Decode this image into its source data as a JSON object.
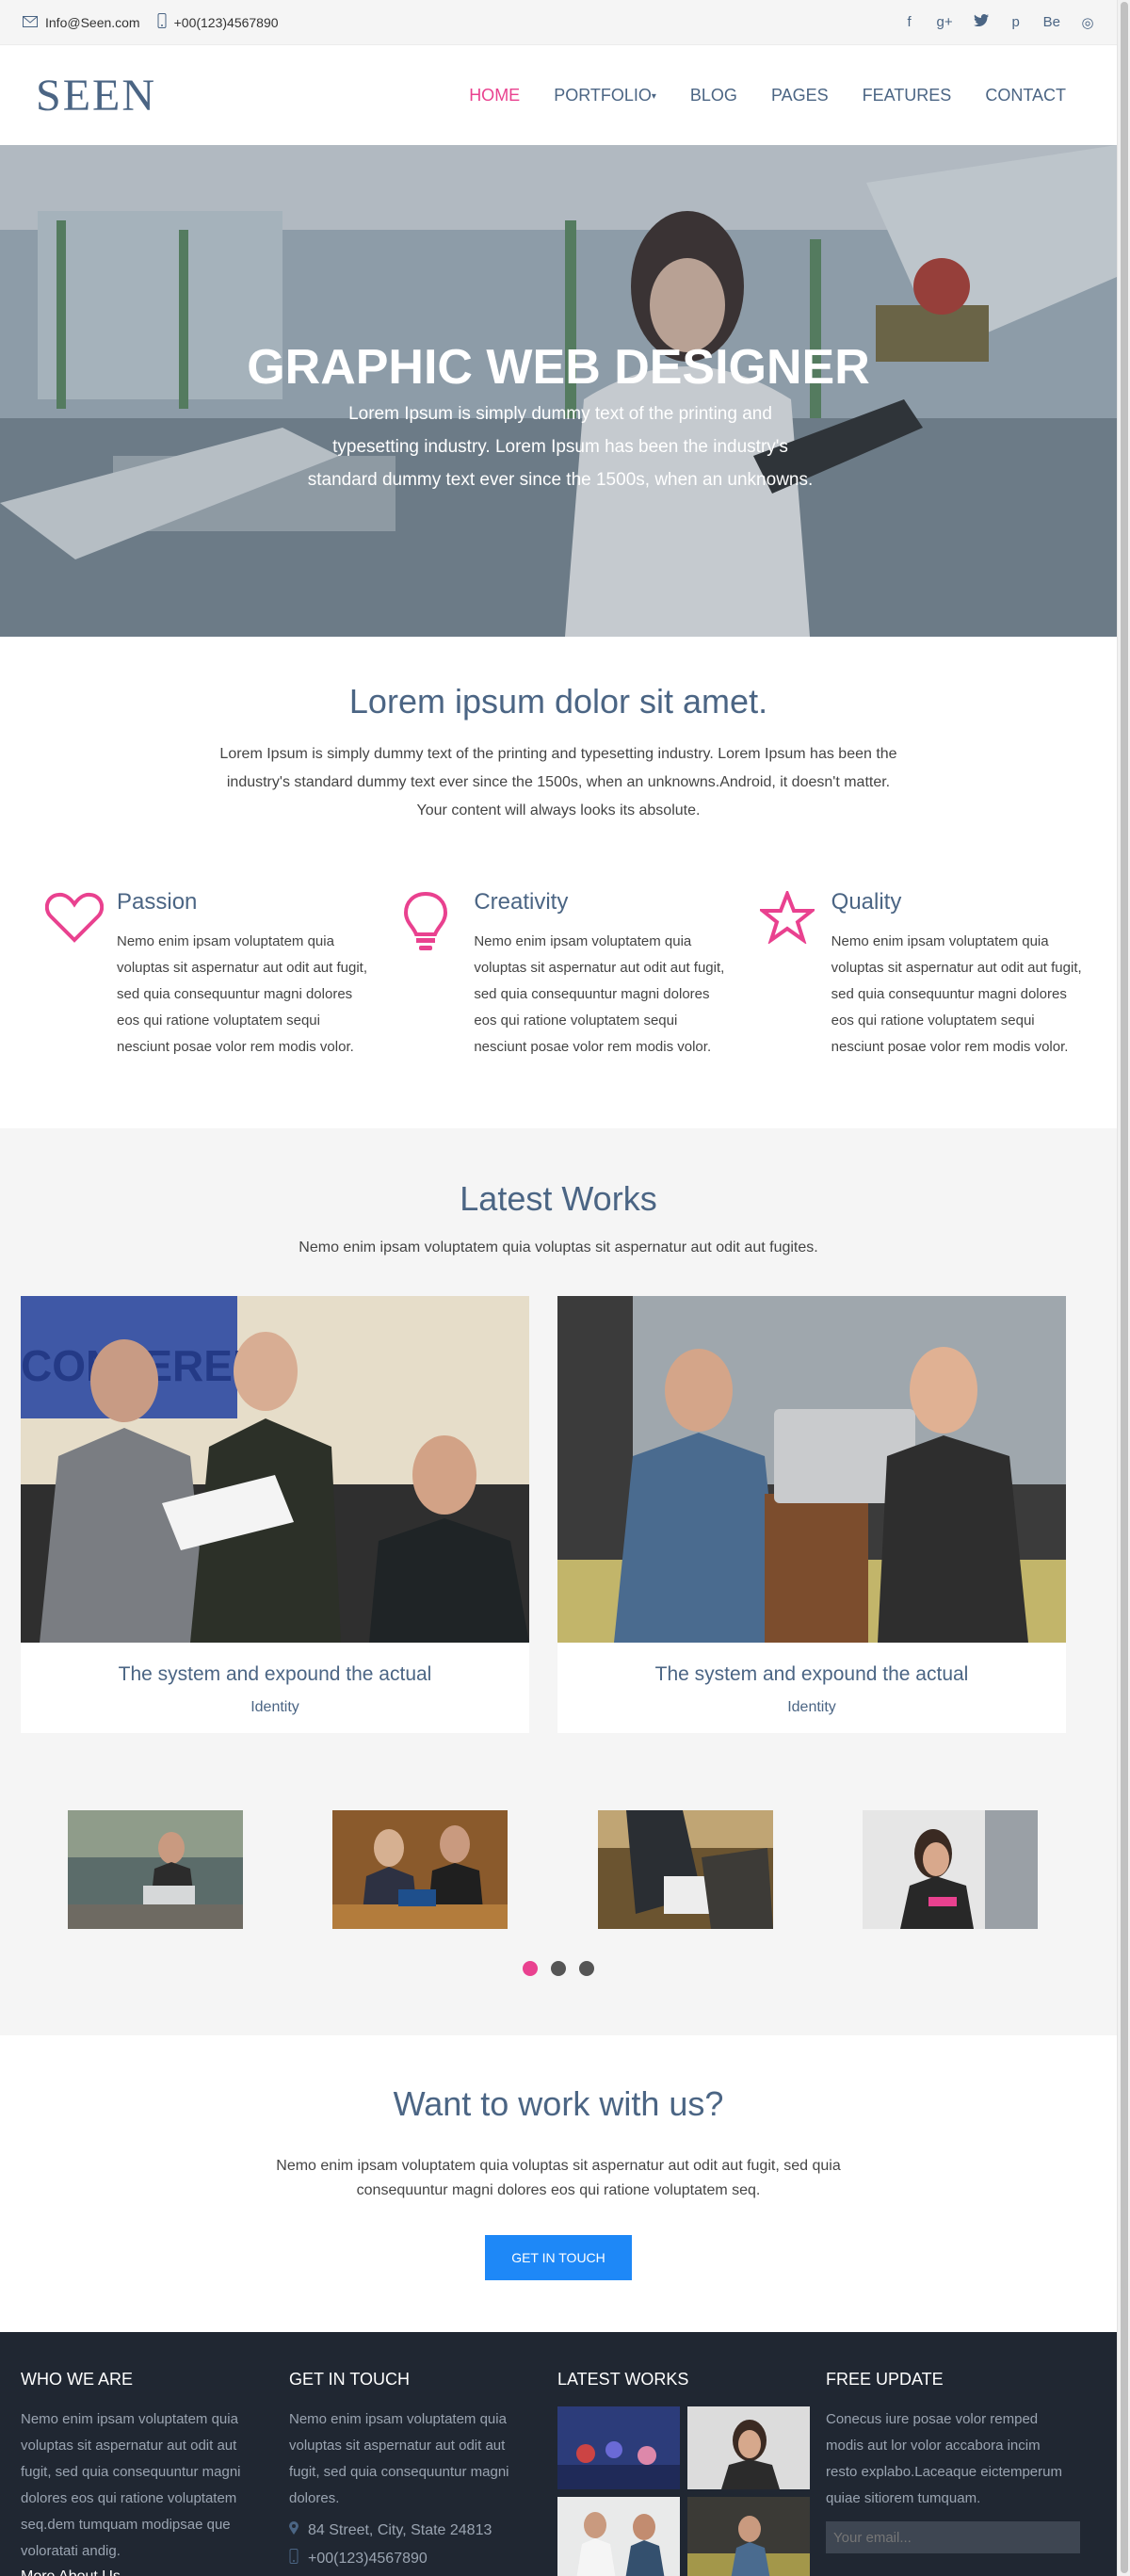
{
  "topbar": {
    "email": "Info@Seen.com",
    "phone": "+00(123)4567890",
    "social": [
      "f",
      "g+",
      "t",
      "p",
      "Be",
      "◎"
    ]
  },
  "header": {
    "logo": "SEEN",
    "nav": [
      "HOME",
      "PORTFOLIO",
      "BLOG",
      "PAGES",
      "FEATURES",
      "CONTACT"
    ],
    "active": "HOME"
  },
  "hero": {
    "title": "GRAPHIC WEB DESIGNER",
    "text": "Lorem Ipsum is simply dummy text of the printing and typesetting industry. Lorem Ipsum has been the industry's standard dummy text ever since the 1500s, when an unknowns."
  },
  "intro": {
    "title": "Lorem ipsum dolor sit amet.",
    "text": "Lorem Ipsum is simply dummy text of the printing and typesetting industry. Lorem Ipsum has been the industry's standard dummy text ever since the 1500s, when an unknowns.Android, it doesn't matter. Your content will always looks its absolute."
  },
  "features": [
    {
      "icon": "heart-icon",
      "title": "Passion",
      "text": "Nemo enim ipsam voluptatem quia voluptas sit aspernatur aut odit aut fugit, sed quia consequuntur magni dolores eos qui ratione voluptatem sequi nesciunt posae volor rem modis volor."
    },
    {
      "icon": "lightbulb-icon",
      "title": "Creativity",
      "text": "Nemo enim ipsam voluptatem quia voluptas sit aspernatur aut odit aut fugit, sed quia consequuntur magni dolores eos qui ratione voluptatem sequi nesciunt posae volor rem modis volor."
    },
    {
      "icon": "star-icon",
      "title": "Quality",
      "text": "Nemo enim ipsam voluptatem quia voluptas sit aspernatur aut odit aut fugit, sed quia consequuntur magni dolores eos qui ratione voluptatem sequi nesciunt posae volor rem modis volor."
    }
  ],
  "works": {
    "title": "Latest Works",
    "subtitle": "Nemo enim ipsam voluptatem quia voluptas sit aspernatur aut odit aut fugites.",
    "cards": [
      {
        "title": "The system and expound the actual",
        "category": "Identity"
      },
      {
        "title": "The system and expound the actual",
        "category": "Identity"
      }
    ],
    "thumbs_count": 4,
    "slider_dots": 3,
    "slider_active": 1
  },
  "cta": {
    "title": "Want to work with us?",
    "text": "Nemo enim ipsam voluptatem quia voluptas sit aspernatur aut odit aut fugit, sed quia consequuntur magni dolores eos qui ratione voluptatem seq.",
    "button": "GET IN TOUCH"
  },
  "footer": {
    "who": {
      "title": "WHO WE ARE",
      "text": "Nemo enim ipsam voluptatem quia voluptas sit aspernatur aut odit aut fugit, sed quia consequuntur magni dolores eos qui ratione voluptatem seq.dem tumquam modipsae que voloratati andig.",
      "more": "More About Us →"
    },
    "touch": {
      "title": "GET IN TOUCH",
      "text": "Nemo enim ipsam voluptatem quia voluptas sit aspernatur aut odit aut fugit, sed quia consequuntur magni dolores.",
      "address": "84 Street, City, State 24813",
      "phone": "+00(123)4567890"
    },
    "latest": {
      "title": "LATEST WORKS"
    },
    "update": {
      "title": "FREE UPDATE",
      "text": "Conecus iure posae volor remped modis  aut lor volor accabora incim resto explabo.Laceaque eictemperum quiae sitiorem tumquam.",
      "placeholder": "Your email..."
    }
  },
  "colors": {
    "accent": "#e9418f",
    "heading": "#4b6584",
    "button": "#1e88f7",
    "footer": "#202732"
  }
}
